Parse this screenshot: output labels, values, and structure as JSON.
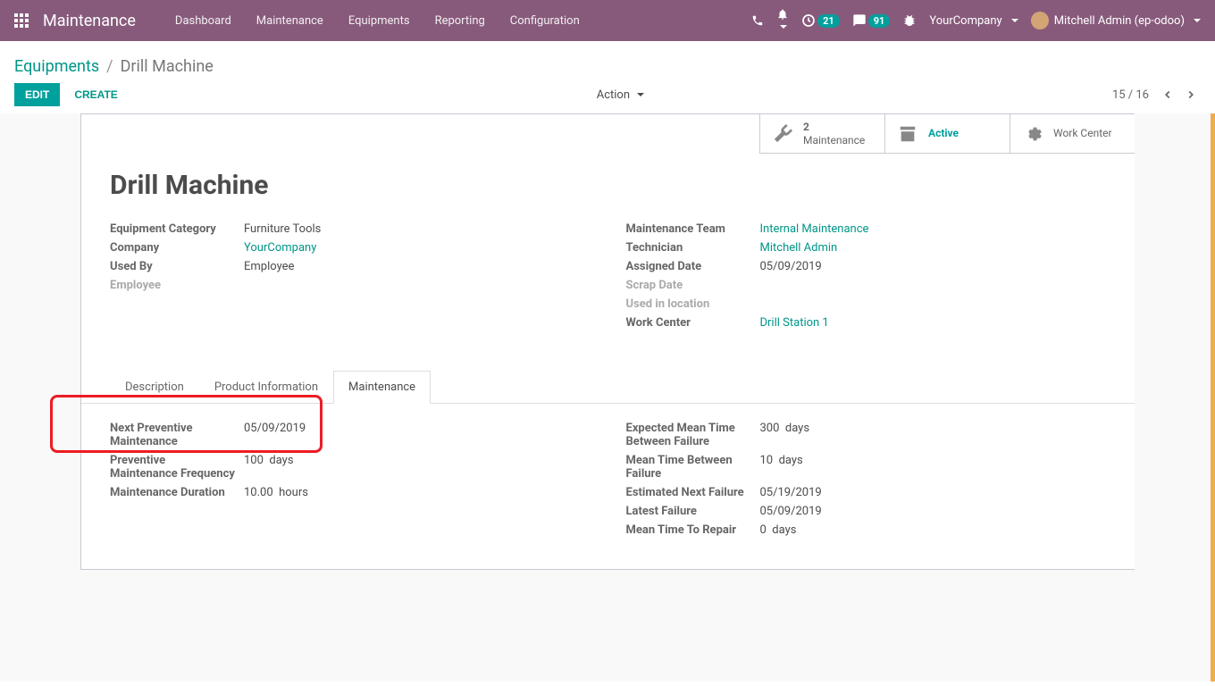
{
  "navbar": {
    "brand": "Maintenance",
    "menu": [
      "Dashboard",
      "Maintenance",
      "Equipments",
      "Reporting",
      "Configuration"
    ],
    "badge1": "21",
    "badge2": "91",
    "company": "YourCompany",
    "user": "Mitchell Admin (ep-odoo)"
  },
  "breadcrumb": {
    "link": "Equipments",
    "sep": "/",
    "current": "Drill Machine"
  },
  "buttons": {
    "edit": "EDIT",
    "create": "CREATE",
    "action": "Action"
  },
  "pager": {
    "text": "15 / 16"
  },
  "stat": {
    "maint_count": "2",
    "maint_label": "Maintenance",
    "active": "Active",
    "workcenter": "Work Center"
  },
  "record": {
    "title": "Drill Machine",
    "left": {
      "category_label": "Equipment Category",
      "category_value": "Furniture Tools",
      "company_label": "Company",
      "company_value": "YourCompany",
      "usedby_label": "Used By",
      "usedby_value": "Employee",
      "employee_label": "Employee"
    },
    "right": {
      "team_label": "Maintenance Team",
      "team_value": "Internal Maintenance",
      "tech_label": "Technician",
      "tech_value": "Mitchell Admin",
      "assigned_label": "Assigned Date",
      "assigned_value": "05/09/2019",
      "scrap_label": "Scrap Date",
      "location_label": "Used in location",
      "workcenter_label": "Work Center",
      "workcenter_value": "Drill Station 1"
    }
  },
  "tabs": {
    "t1": "Description",
    "t2": "Product Information",
    "t3": "Maintenance"
  },
  "maint": {
    "next_label": "Next Preventive Maintenance",
    "next_value": "05/09/2019",
    "freq_label": "Preventive Maintenance Frequency",
    "freq_value": "100",
    "freq_unit": "days",
    "dur_label": "Maintenance Duration",
    "dur_value": "10.00",
    "dur_unit": "hours",
    "emtbf_label": "Expected Mean Time Between Failure",
    "emtbf_value": "300",
    "emtbf_unit": "days",
    "mtbf_label": "Mean Time Between Failure",
    "mtbf_value": "10",
    "mtbf_unit": "days",
    "enf_label": "Estimated Next Failure",
    "enf_value": "05/19/2019",
    "latest_label": "Latest Failure",
    "latest_value": "05/09/2019",
    "mttr_label": "Mean Time To Repair",
    "mttr_value": "0",
    "mttr_unit": "days"
  }
}
